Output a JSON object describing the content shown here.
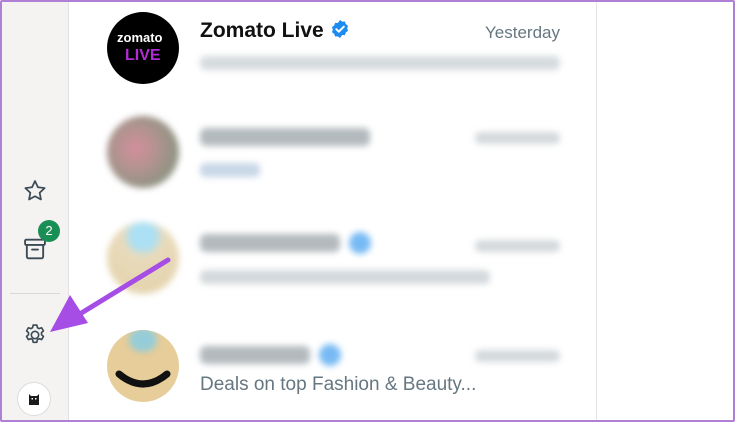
{
  "sidebar": {
    "starred_icon": "star-icon",
    "archived_icon": "archive-icon",
    "archived_badge": "2",
    "settings_icon": "gear-icon",
    "profile_icon": "profile-avatar-icon"
  },
  "chats": [
    {
      "name": "Zomato Live",
      "verified": true,
      "time": "Yesterday",
      "preview": "",
      "avatar_text": "zomato LIVE"
    },
    {
      "name": "",
      "verified": false,
      "time": "",
      "preview": ""
    },
    {
      "name": "",
      "verified": true,
      "time": "",
      "preview": ""
    },
    {
      "name": "",
      "verified": true,
      "time": "",
      "preview": "Deals on top Fashion & Beauty..."
    }
  ],
  "colors": {
    "accent_green": "#1a8f55",
    "verified_blue": "#1d8cf0",
    "annotation_purple": "#a64de6"
  }
}
